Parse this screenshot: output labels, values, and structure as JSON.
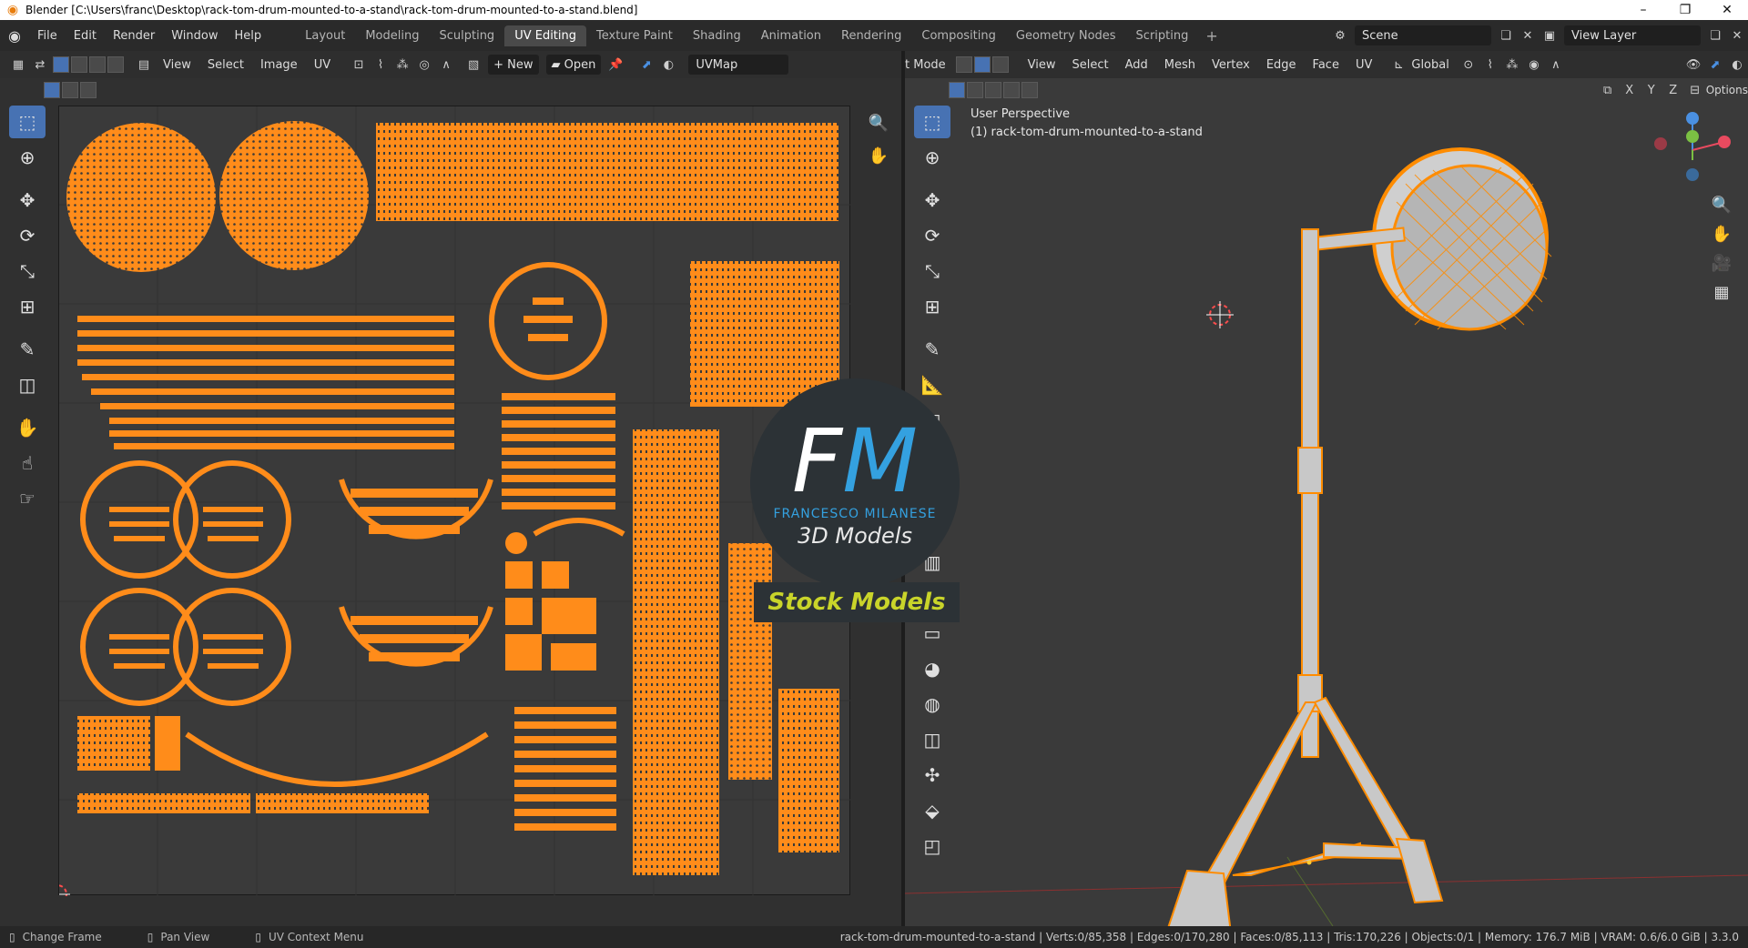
{
  "window": {
    "title": "Blender [C:\\Users\\franc\\Desktop\\rack-tom-drum-mounted-to-a-stand\\rack-tom-drum-mounted-to-a-stand.blend]",
    "minimize": "–",
    "restore": "❐",
    "close": "✕"
  },
  "menubar": {
    "items": [
      "File",
      "Edit",
      "Render",
      "Window",
      "Help"
    ],
    "workspaces": [
      "Layout",
      "Modeling",
      "Sculpting",
      "UV Editing",
      "Texture Paint",
      "Shading",
      "Animation",
      "Rendering",
      "Compositing",
      "Geometry Nodes",
      "Scripting"
    ],
    "active_workspace": "UV Editing",
    "add": "+",
    "scene": "Scene",
    "view_layer": "View Layer"
  },
  "uv_editor": {
    "menus": [
      "View",
      "Select",
      "Image",
      "UV"
    ],
    "new_label": "New",
    "open_label": "Open",
    "uvmap": "UVMap"
  },
  "viewport": {
    "mode": "t Mode",
    "menus": [
      "View",
      "Select",
      "Add",
      "Mesh",
      "Vertex",
      "Edge",
      "Face",
      "UV"
    ],
    "transform_orientation": "Global",
    "options_label": "Options",
    "axes": [
      "X",
      "Y",
      "Z"
    ],
    "perspective": "User Perspective",
    "object_label": "(1) rack-tom-drum-mounted-to-a-stand"
  },
  "watermark": {
    "fm_f": "F",
    "fm_m": "M",
    "name": "FRANCESCO MILANESE",
    "tagline": "3D Models",
    "stock": "Stock Models"
  },
  "statusbar": {
    "left": [
      {
        "icon": "mouse-left-icon",
        "label": "Change Frame"
      },
      {
        "icon": "mouse-middle-icon",
        "label": "Pan View"
      },
      {
        "icon": "mouse-right-icon",
        "label": "UV Context Menu"
      }
    ],
    "stats": "rack-tom-drum-mounted-to-a-stand | Verts:0/85,358 | Edges:0/170,280 | Faces:0/85,113 | Tris:170,226 | Objects:0/1 | Memory: 176.7 MiB | VRAM: 0.6/6.0 GiB | 3.3.0"
  },
  "colors": {
    "uv_orange": "#ff8c1a",
    "accent_blue": "#4772b3",
    "wire_orange": "#ff8c00"
  }
}
